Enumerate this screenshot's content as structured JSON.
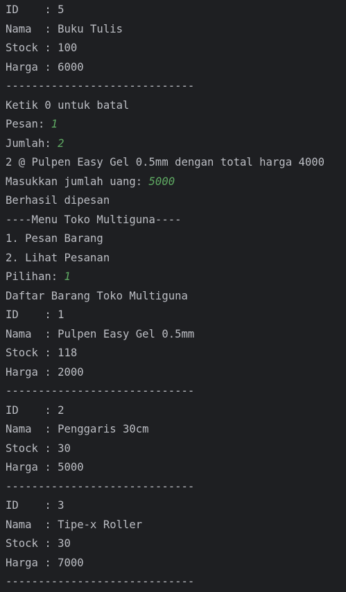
{
  "console": {
    "lines": [
      {
        "text": "ID    : 5"
      },
      {
        "text": "Nama  : Buku Tulis"
      },
      {
        "text": "Stock : 100"
      },
      {
        "text": "Harga : 6000"
      },
      {
        "text": "-----------------------------"
      },
      {
        "text": "Ketik 0 untuk batal"
      },
      {
        "text": "Pesan: ",
        "input": "1"
      },
      {
        "text": "Jumlah: ",
        "input": "2"
      },
      {
        "text": "2 @ Pulpen Easy Gel 0.5mm dengan total harga 4000"
      },
      {
        "text": "Masukkan jumlah uang: ",
        "input": "5000"
      },
      {
        "text": "Berhasil dipesan"
      },
      {
        "text": "----Menu Toko Multiguna----"
      },
      {
        "text": "1. Pesan Barang"
      },
      {
        "text": "2. Lihat Pesanan"
      },
      {
        "text": "Pilihan: ",
        "input": "1"
      },
      {
        "text": "Daftar Barang Toko Multiguna"
      },
      {
        "text": "ID    : 1"
      },
      {
        "text": "Nama  : Pulpen Easy Gel 0.5mm"
      },
      {
        "text": "Stock : 118"
      },
      {
        "text": "Harga : 2000"
      },
      {
        "text": "-----------------------------"
      },
      {
        "text": "ID    : 2"
      },
      {
        "text": "Nama  : Penggaris 30cm"
      },
      {
        "text": "Stock : 30"
      },
      {
        "text": "Harga : 5000"
      },
      {
        "text": "-----------------------------"
      },
      {
        "text": "ID    : 3"
      },
      {
        "text": "Nama  : Tipe-x Roller"
      },
      {
        "text": "Stock : 30"
      },
      {
        "text": "Harga : 7000"
      },
      {
        "text": "-----------------------------"
      }
    ]
  },
  "colors": {
    "background": "#1e1f22",
    "text": "#bcbec4",
    "user_input": "#5faa63"
  }
}
